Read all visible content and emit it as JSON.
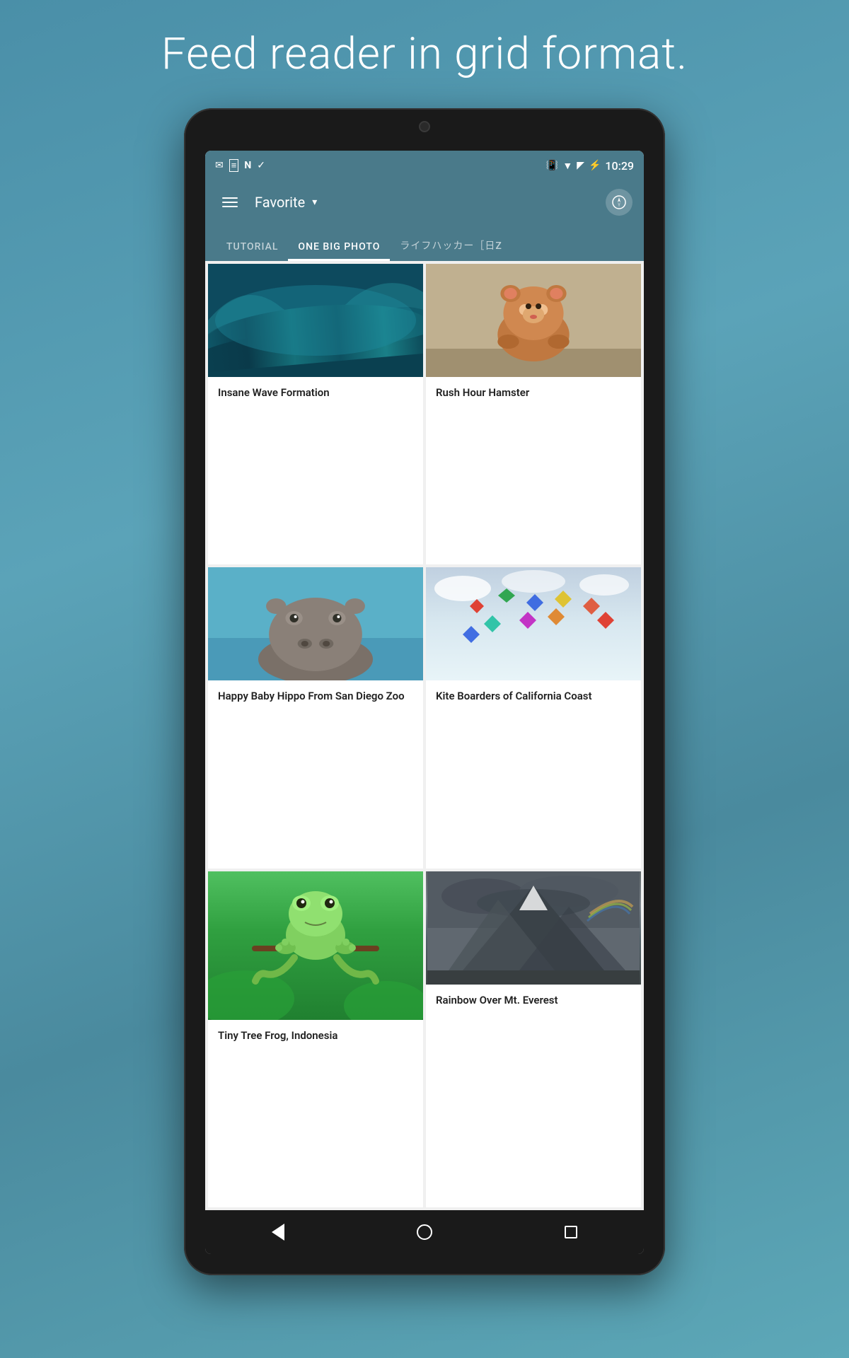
{
  "page": {
    "title": "Feed reader in grid format.",
    "background_top": "#4a8fa8",
    "background_bottom": "#6aabb8"
  },
  "status_bar": {
    "time": "10:29",
    "icons_left": [
      "mail-icon",
      "news-icon",
      "n-icon",
      "check-icon"
    ],
    "icons_right": [
      "vibrate-icon",
      "wifi-icon",
      "signal-icon",
      "battery-icon"
    ]
  },
  "header": {
    "menu_label": "☰",
    "title": "Favorite",
    "dropdown_symbol": "▾",
    "compass_symbol": "⊕"
  },
  "tabs": [
    {
      "label": "TUTORIAL",
      "active": false
    },
    {
      "label": "ONE BIG PHOTO",
      "active": true
    },
    {
      "label": "ライフハッカー［日z",
      "active": false
    }
  ],
  "grid_items": [
    {
      "id": "wave",
      "title": "Insane Wave Formation",
      "image_type": "wave"
    },
    {
      "id": "hamster",
      "title": "Rush Hour Hamster",
      "image_type": "hamster"
    },
    {
      "id": "hippo",
      "title": "Happy Baby Hippo From San Diego Zoo",
      "image_type": "hippo"
    },
    {
      "id": "kite",
      "title": "Kite Boarders of California Coast",
      "image_type": "kite"
    },
    {
      "id": "frog",
      "title": "Tiny Tree Frog, Indonesia",
      "image_type": "frog"
    },
    {
      "id": "mountain",
      "title": "Rainbow Over Mt. Everest",
      "image_type": "mountain"
    }
  ],
  "bottom_nav": {
    "back_label": "◁",
    "home_label": "○",
    "square_label": "□"
  }
}
